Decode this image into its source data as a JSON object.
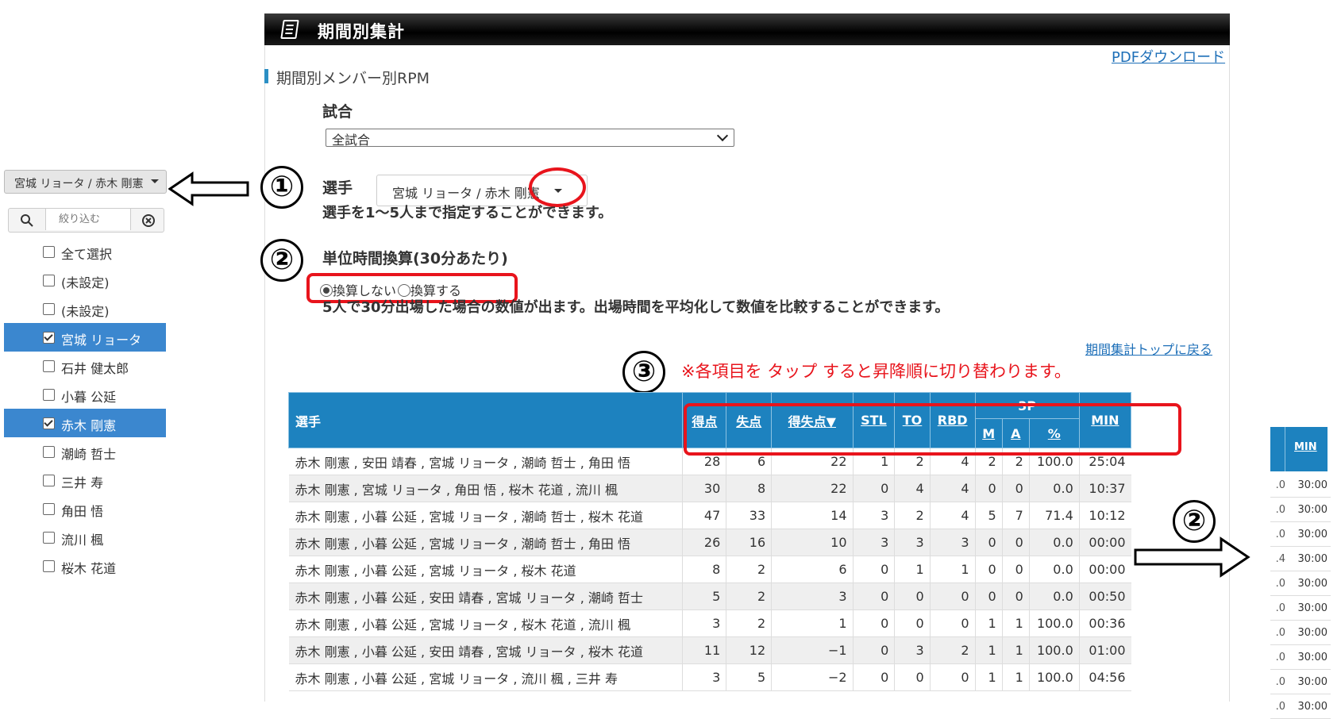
{
  "header": {
    "title": "期間別集計"
  },
  "pdf_link": "PDFダウンロード",
  "section_title": "期間別メンバー別RPM",
  "game": {
    "label": "試合",
    "selected": "全試合"
  },
  "player": {
    "label": "選手",
    "button_text": "宮城 リョータ / 赤木 剛憲",
    "note": "選手を1〜5人まで指定することができます。"
  },
  "unit": {
    "label": "単位時間換算(30分あたり)",
    "option_off": "換算しない",
    "option_on": "換算する",
    "note": "5人で30分出場した場合の数値が出ます。出場時間を平均化して数値を比較することができます。"
  },
  "back_link": "期間集計トップに戻る",
  "sort_note": "※各項目を タップ すると昇降順に切り替わります。",
  "callouts": {
    "c1": "①",
    "c2": "②",
    "c3": "③",
    "c2b": "②"
  },
  "table": {
    "headers": {
      "player": "選手",
      "pts": "得点",
      "lost": "失点",
      "diff": "得失点▼",
      "stl": "STL",
      "to": "TO",
      "rbd": "RBD",
      "tp": "3P",
      "m": "M",
      "a": "A",
      "pct": "%",
      "min": "MIN"
    },
    "rows": [
      {
        "name": "赤木 剛憲 , 安田 靖春 , 宮城 リョータ , 潮崎 哲士 , 角田 悟",
        "pts": "28",
        "lost": "6",
        "diff": "22",
        "stl": "1",
        "to": "2",
        "rbd": "4",
        "m": "2",
        "a": "2",
        "pct": "100.0",
        "min": "25:04"
      },
      {
        "name": "赤木 剛憲 , 宮城 リョータ , 角田 悟 , 桜木 花道 , 流川 楓",
        "pts": "30",
        "lost": "8",
        "diff": "22",
        "stl": "0",
        "to": "4",
        "rbd": "4",
        "m": "0",
        "a": "0",
        "pct": "0.0",
        "min": "10:37"
      },
      {
        "name": "赤木 剛憲 , 小暮 公延 , 宮城 リョータ , 潮崎 哲士 , 桜木 花道",
        "pts": "47",
        "lost": "33",
        "diff": "14",
        "stl": "3",
        "to": "2",
        "rbd": "4",
        "m": "5",
        "a": "7",
        "pct": "71.4",
        "min": "10:12"
      },
      {
        "name": "赤木 剛憲 , 小暮 公延 , 宮城 リョータ , 潮崎 哲士 , 角田 悟",
        "pts": "26",
        "lost": "16",
        "diff": "10",
        "stl": "3",
        "to": "3",
        "rbd": "3",
        "m": "0",
        "a": "0",
        "pct": "0.0",
        "min": "00:00"
      },
      {
        "name": "赤木 剛憲 , 小暮 公延 , 宮城 リョータ , 桜木 花道",
        "pts": "8",
        "lost": "2",
        "diff": "6",
        "stl": "0",
        "to": "1",
        "rbd": "1",
        "m": "0",
        "a": "0",
        "pct": "0.0",
        "min": "00:00"
      },
      {
        "name": "赤木 剛憲 , 小暮 公延 , 安田 靖春 , 宮城 リョータ , 潮崎 哲士",
        "pts": "5",
        "lost": "2",
        "diff": "3",
        "stl": "0",
        "to": "0",
        "rbd": "0",
        "m": "0",
        "a": "0",
        "pct": "0.0",
        "min": "00:50"
      },
      {
        "name": "赤木 剛憲 , 小暮 公延 , 宮城 リョータ , 桜木 花道 , 流川 楓",
        "pts": "3",
        "lost": "2",
        "diff": "1",
        "stl": "0",
        "to": "0",
        "rbd": "0",
        "m": "1",
        "a": "1",
        "pct": "100.0",
        "min": "00:36"
      },
      {
        "name": "赤木 剛憲 , 小暮 公延 , 安田 靖春 , 宮城 リョータ , 桜木 花道",
        "pts": "11",
        "lost": "12",
        "diff": "−1",
        "stl": "0",
        "to": "3",
        "rbd": "2",
        "m": "1",
        "a": "1",
        "pct": "100.0",
        "min": "01:00"
      },
      {
        "name": "赤木 剛憲 , 小暮 公延 , 宮城 リョータ , 流川 楓 , 三井 寿",
        "pts": "3",
        "lost": "5",
        "diff": "−2",
        "stl": "0",
        "to": "0",
        "rbd": "0",
        "m": "1",
        "a": "1",
        "pct": "100.0",
        "min": "04:56"
      }
    ]
  },
  "left_panel": {
    "button_text": "宮城 リョータ / 赤木 剛憲",
    "search_placeholder": "絞り込む",
    "items": [
      {
        "label": "全て選択",
        "checked": false
      },
      {
        "label": "(未設定)",
        "checked": false
      },
      {
        "label": "(未設定)",
        "checked": false
      },
      {
        "label": "宮城 リョータ",
        "checked": true
      },
      {
        "label": "石井 健太郎",
        "checked": false
      },
      {
        "label": "小暮 公延",
        "checked": false
      },
      {
        "label": "赤木 剛憲",
        "checked": true
      },
      {
        "label": "潮崎 哲士",
        "checked": false
      },
      {
        "label": "三井 寿",
        "checked": false
      },
      {
        "label": "角田 悟",
        "checked": false
      },
      {
        "label": "流川 楓",
        "checked": false
      },
      {
        "label": "桜木 花道",
        "checked": false
      }
    ]
  },
  "right_fragment": {
    "header": "MIN",
    "rows": [
      {
        "cut": ".0",
        "min": "30:00"
      },
      {
        "cut": ".0",
        "min": "30:00"
      },
      {
        "cut": ".0",
        "min": "30:00"
      },
      {
        "cut": ".4",
        "min": "30:00"
      },
      {
        "cut": ".0",
        "min": "30:00"
      },
      {
        "cut": ".0",
        "min": "30:00"
      },
      {
        "cut": ".0",
        "min": "30:00"
      },
      {
        "cut": ".0",
        "min": "30:00"
      },
      {
        "cut": ".0",
        "min": "30:00"
      },
      {
        "cut": ".0",
        "min": "30:00"
      }
    ]
  },
  "colors": {
    "accent": "#1d82bf",
    "callout_red": "#e8141c",
    "selected_row": "#3b87cf"
  }
}
